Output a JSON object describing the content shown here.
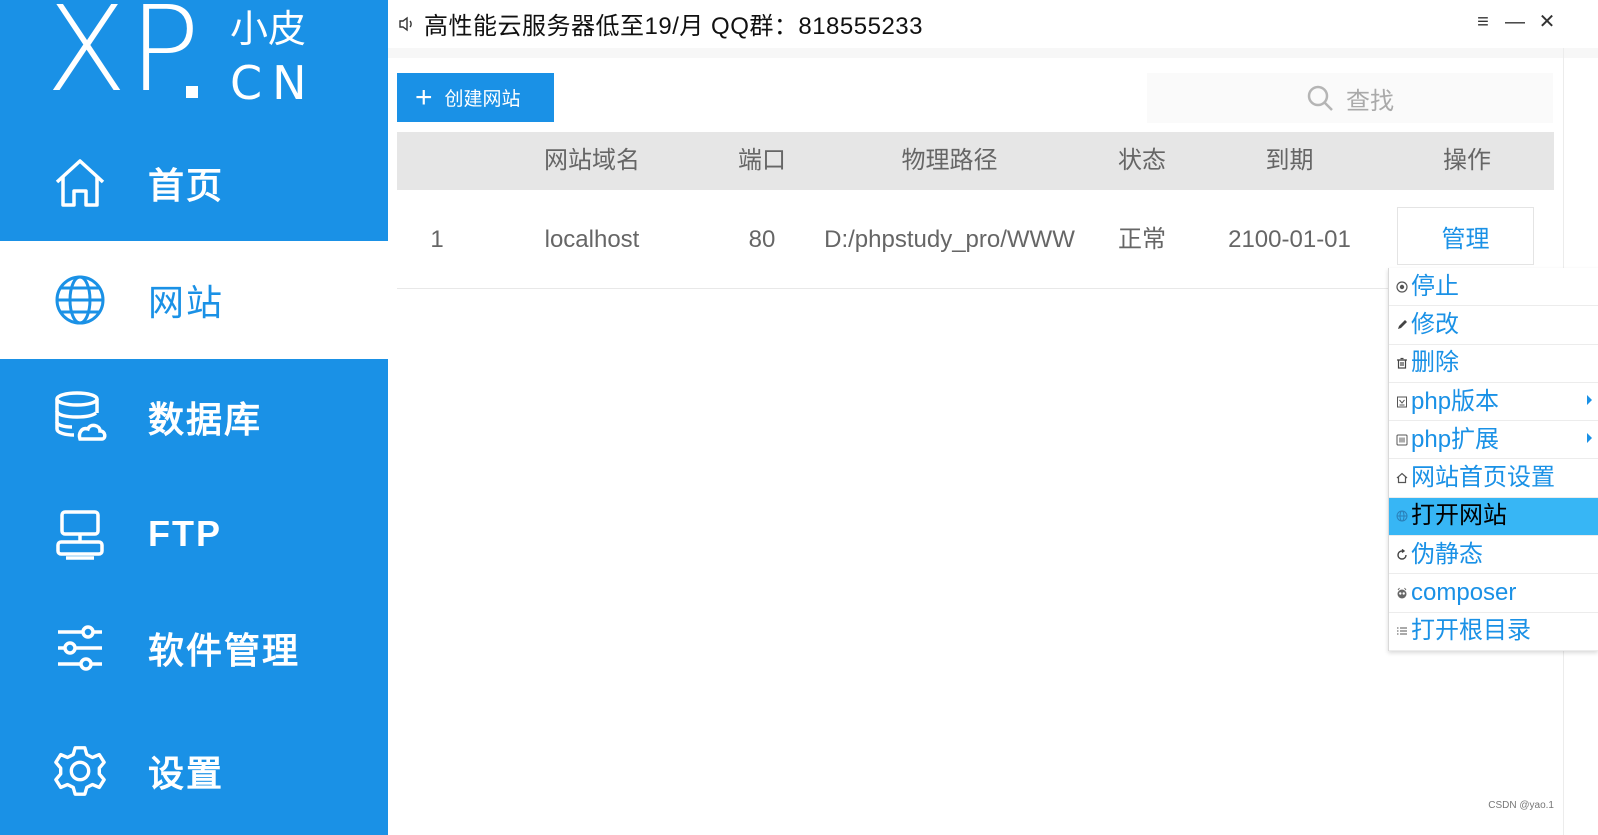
{
  "logo": {
    "main": "XP",
    "small": "小皮",
    "cn": "CN"
  },
  "nav": {
    "items": [
      {
        "label": "首页",
        "icon": "home-icon",
        "active": false
      },
      {
        "label": "网站",
        "icon": "globe-icon",
        "active": true
      },
      {
        "label": "数据库",
        "icon": "database-icon",
        "active": false
      },
      {
        "label": "FTP",
        "icon": "ftp-icon",
        "active": false
      },
      {
        "label": "软件管理",
        "icon": "sliders-icon",
        "active": false
      },
      {
        "label": "设置",
        "icon": "gear-icon",
        "active": false
      }
    ]
  },
  "topbar": {
    "announcement": "高性能云服务器低至19/月  QQ群：818555233",
    "menu_symbol": "≡",
    "minimize_symbol": "—",
    "close_symbol": "✕"
  },
  "toolbar": {
    "create_label": "创建网站",
    "search_placeholder": "查找"
  },
  "table": {
    "headers": [
      "网站域名",
      "端口",
      "物理路径",
      "状态",
      "到期",
      "操作"
    ],
    "rows": [
      {
        "index": "1",
        "domain": "localhost",
        "port": "80",
        "path": "D:/phpstudy_pro/WWW",
        "status": "正常",
        "expiry": "2100-01-01",
        "action": "管理"
      }
    ]
  },
  "context_menu": {
    "items": [
      {
        "label": "停止",
        "icon": "stop-icon",
        "submenu": false,
        "highlighted": false
      },
      {
        "label": "修改",
        "icon": "pencil-icon",
        "submenu": false,
        "highlighted": false
      },
      {
        "label": "删除",
        "icon": "trash-icon",
        "submenu": false,
        "highlighted": false
      },
      {
        "label": "php版本",
        "icon": "version-icon",
        "submenu": true,
        "highlighted": false
      },
      {
        "label": "php扩展",
        "icon": "extension-icon",
        "submenu": true,
        "highlighted": false
      },
      {
        "label": "网站首页设置",
        "icon": "home-small-icon",
        "submenu": false,
        "highlighted": false
      },
      {
        "label": "打开网站",
        "icon": "globe-small-icon",
        "submenu": false,
        "highlighted": true
      },
      {
        "label": "伪静态",
        "icon": "refresh-icon",
        "submenu": false,
        "highlighted": false
      },
      {
        "label": "composer",
        "icon": "composer-icon",
        "submenu": false,
        "highlighted": false
      },
      {
        "label": "打开根目录",
        "icon": "list-icon",
        "submenu": false,
        "highlighted": false
      }
    ]
  },
  "watermark": "CSDN @yao.1",
  "colors": {
    "primary": "#1a91e6",
    "highlight": "#37b6f5",
    "header_bg": "#e6e6e6"
  }
}
